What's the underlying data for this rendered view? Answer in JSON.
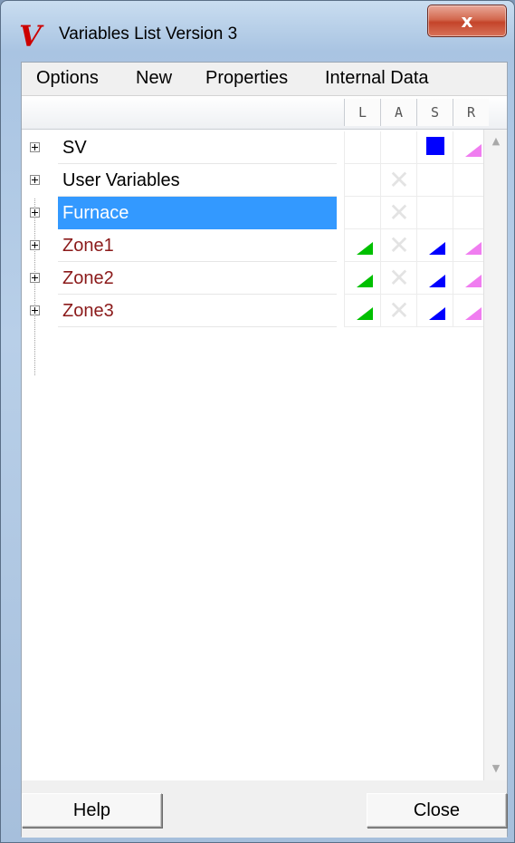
{
  "window": {
    "title": "Variables List Version 3",
    "close_glyph": "x"
  },
  "menu": [
    "Options",
    "New",
    "Properties",
    "Internal Data"
  ],
  "columns": [
    "L",
    "A",
    "S",
    "R"
  ],
  "rows": [
    {
      "label": "SV",
      "color": "#000000",
      "selected": false,
      "L": null,
      "A": null,
      "S": "square-blue",
      "R": "triangle-pink"
    },
    {
      "label": "User Variables",
      "color": "#000000",
      "selected": false,
      "L": null,
      "A": "x-disabled",
      "S": null,
      "R": null
    },
    {
      "label": "Furnace",
      "color": "#ffffff",
      "selected": true,
      "L": null,
      "A": "x-disabled",
      "S": null,
      "R": null
    },
    {
      "label": "Zone1",
      "color": "#8b1a1a",
      "selected": false,
      "L": "triangle-green",
      "A": "x-disabled",
      "S": "triangle-blue",
      "R": "triangle-pink"
    },
    {
      "label": "Zone2",
      "color": "#8b1a1a",
      "selected": false,
      "L": "triangle-green",
      "A": "x-disabled",
      "S": "triangle-blue",
      "R": "triangle-pink"
    },
    {
      "label": "Zone3",
      "color": "#8b1a1a",
      "selected": false,
      "L": "triangle-green",
      "A": "x-disabled",
      "S": "triangle-blue",
      "R": "triangle-pink"
    }
  ],
  "colors": {
    "green": "#00c000",
    "blue": "#0000ff",
    "pink": "#f07df0",
    "selection": "#3399ff"
  },
  "buttons": {
    "help": "Help",
    "close": "Close"
  }
}
